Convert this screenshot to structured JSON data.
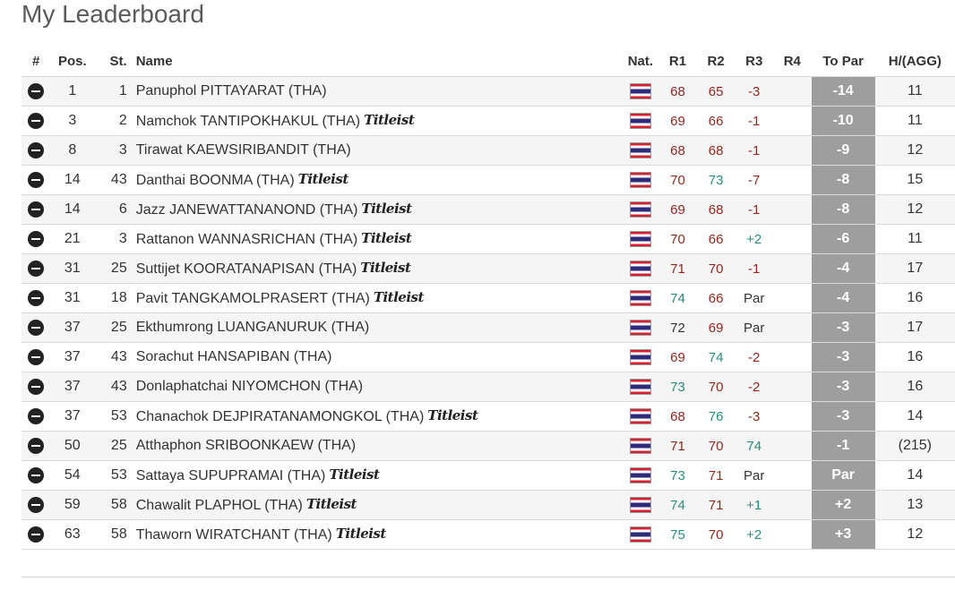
{
  "title": "My Leaderboard",
  "headers": {
    "num": "#",
    "pos": "Pos.",
    "st": "St.",
    "name": "Name",
    "nat": "Nat.",
    "r1": "R1",
    "r2": "R2",
    "r3": "R3",
    "r4": "R4",
    "topar": "To Par",
    "agg": "H/(AGG)"
  },
  "colors": {
    "under_par": "#8e2a1f",
    "over_par": "#2a8d7d",
    "topar_bg": "#9e9e9e"
  },
  "icons": {
    "row_action": "minus-circle-icon",
    "nationality": "thailand-flag-icon",
    "sponsor": "titleist-logo"
  },
  "sponsor_text": "Titleist",
  "rows": [
    {
      "pos": "1",
      "st": "1",
      "name": "Panuphol PITTAYARAT (THA)",
      "logo": false,
      "r1": "68",
      "r1c": "under",
      "r2": "65",
      "r2c": "under",
      "r3": "-3",
      "r3c": "under",
      "r4": "",
      "topar": "-14",
      "agg": "11"
    },
    {
      "pos": "3",
      "st": "2",
      "name": "Namchok TANTIPOKHAKUL (THA)",
      "logo": true,
      "r1": "69",
      "r1c": "under",
      "r2": "66",
      "r2c": "under",
      "r3": "-1",
      "r3c": "under",
      "r4": "",
      "topar": "-10",
      "agg": "11"
    },
    {
      "pos": "8",
      "st": "3",
      "name": "Tirawat KAEWSIRIBANDIT (THA)",
      "logo": false,
      "r1": "68",
      "r1c": "under",
      "r2": "68",
      "r2c": "under",
      "r3": "-1",
      "r3c": "under",
      "r4": "",
      "topar": "-9",
      "agg": "12"
    },
    {
      "pos": "14",
      "st": "43",
      "name": "Danthai BOONMA (THA)",
      "logo": true,
      "r1": "70",
      "r1c": "under",
      "r2": "73",
      "r2c": "over",
      "r3": "-7",
      "r3c": "under",
      "r4": "",
      "topar": "-8",
      "agg": "15"
    },
    {
      "pos": "14",
      "st": "6",
      "name": "Jazz JANEWATTANANOND (THA)",
      "logo": true,
      "r1": "69",
      "r1c": "under",
      "r2": "68",
      "r2c": "under",
      "r3": "-1",
      "r3c": "under",
      "r4": "",
      "topar": "-8",
      "agg": "12"
    },
    {
      "pos": "21",
      "st": "3",
      "name": "Rattanon WANNASRICHAN (THA)",
      "logo": true,
      "r1": "70",
      "r1c": "under",
      "r2": "66",
      "r2c": "under",
      "r3": "+2",
      "r3c": "over",
      "r4": "",
      "topar": "-6",
      "agg": "11"
    },
    {
      "pos": "31",
      "st": "25",
      "name": "Suttijet KOORATANAPISAN (THA)",
      "logo": true,
      "r1": "71",
      "r1c": "under",
      "r2": "70",
      "r2c": "under",
      "r3": "-1",
      "r3c": "under",
      "r4": "",
      "topar": "-4",
      "agg": "17"
    },
    {
      "pos": "31",
      "st": "18",
      "name": "Pavit TANGKAMOLPRASERT (THA)",
      "logo": true,
      "r1": "74",
      "r1c": "over",
      "r2": "66",
      "r2c": "under",
      "r3": "Par",
      "r3c": "even",
      "r4": "",
      "topar": "-4",
      "agg": "16"
    },
    {
      "pos": "37",
      "st": "25",
      "name": "Ekthumrong LUANGANURUK (THA)",
      "logo": false,
      "r1": "72",
      "r1c": "even",
      "r2": "69",
      "r2c": "under",
      "r3": "Par",
      "r3c": "even",
      "r4": "",
      "topar": "-3",
      "agg": "17"
    },
    {
      "pos": "37",
      "st": "43",
      "name": "Sorachut HANSAPIBAN (THA)",
      "logo": false,
      "r1": "69",
      "r1c": "under",
      "r2": "74",
      "r2c": "over",
      "r3": "-2",
      "r3c": "under",
      "r4": "",
      "topar": "-3",
      "agg": "16"
    },
    {
      "pos": "37",
      "st": "43",
      "name": "Donlaphatchai NIYOMCHON (THA)",
      "logo": false,
      "r1": "73",
      "r1c": "over",
      "r2": "70",
      "r2c": "under",
      "r3": "-2",
      "r3c": "under",
      "r4": "",
      "topar": "-3",
      "agg": "16"
    },
    {
      "pos": "37",
      "st": "53",
      "name": "Chanachok DEJPIRATANAMONGKOL (THA)",
      "logo": true,
      "r1": "68",
      "r1c": "under",
      "r2": "76",
      "r2c": "over",
      "r3": "-3",
      "r3c": "under",
      "r4": "",
      "topar": "-3",
      "agg": "14"
    },
    {
      "pos": "50",
      "st": "25",
      "name": "Atthaphon SRIBOONKAEW (THA)",
      "logo": false,
      "r1": "71",
      "r1c": "under",
      "r2": "70",
      "r2c": "under",
      "r3": "74",
      "r3c": "over",
      "r4": "",
      "topar": "-1",
      "agg": "(215)"
    },
    {
      "pos": "54",
      "st": "53",
      "name": "Sattaya SUPUPRAMAI (THA)",
      "logo": true,
      "r1": "73",
      "r1c": "over",
      "r2": "71",
      "r2c": "under",
      "r3": "Par",
      "r3c": "even",
      "r4": "",
      "topar": "Par",
      "agg": "14"
    },
    {
      "pos": "59",
      "st": "58",
      "name": "Chawalit PLAPHOL (THA)",
      "logo": true,
      "r1": "74",
      "r1c": "over",
      "r2": "71",
      "r2c": "under",
      "r3": "+1",
      "r3c": "over",
      "r4": "",
      "topar": "+2",
      "agg": "13"
    },
    {
      "pos": "63",
      "st": "58",
      "name": "Thaworn WIRATCHANT (THA)",
      "logo": true,
      "r1": "75",
      "r1c": "over",
      "r2": "70",
      "r2c": "under",
      "r3": "+2",
      "r3c": "over",
      "r4": "",
      "topar": "+3",
      "agg": "12"
    }
  ]
}
